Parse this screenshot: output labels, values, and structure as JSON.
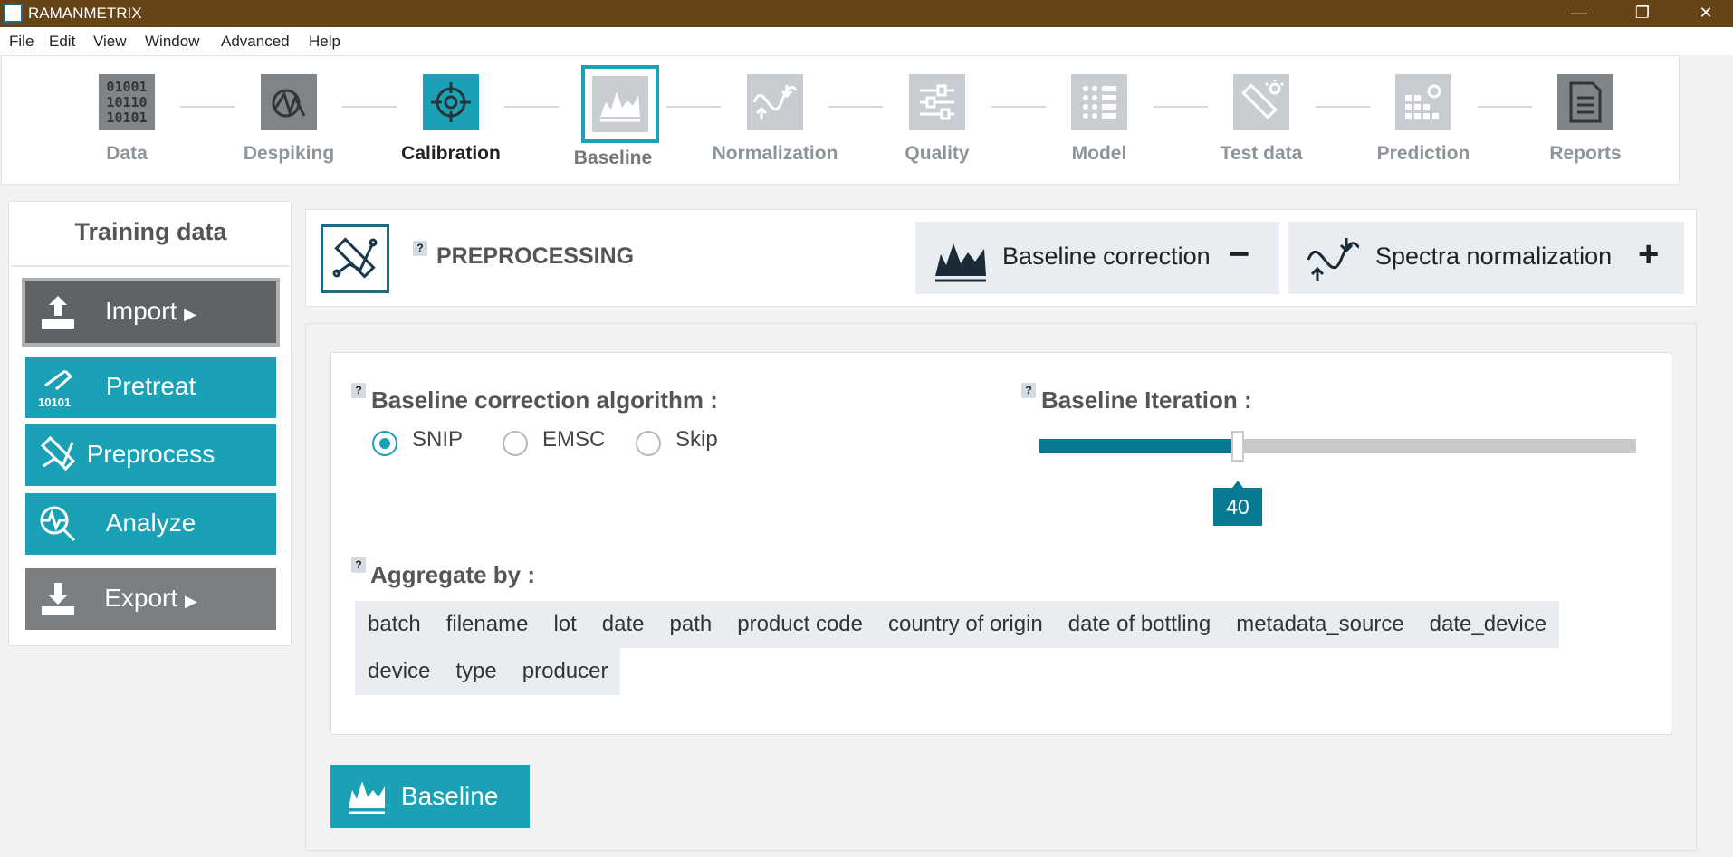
{
  "window": {
    "title": "RAMANMETRIX",
    "minimize": "—",
    "maximize": "❐",
    "close": "✕"
  },
  "menu": [
    "File",
    "Edit",
    "View",
    "Window",
    "Advanced",
    "Help"
  ],
  "workflow": {
    "steps": [
      {
        "label": "Data",
        "icon": "binary-data-icon"
      },
      {
        "label": "Despiking",
        "icon": "despiking-icon"
      },
      {
        "label": "Calibration",
        "icon": "crosshair-icon"
      },
      {
        "label": "Baseline",
        "icon": "baseline-spectrum-icon"
      },
      {
        "label": "Normalization",
        "icon": "normalization-icon"
      },
      {
        "label": "Quality",
        "icon": "sliders-icon"
      },
      {
        "label": "Model",
        "icon": "grid-model-icon"
      },
      {
        "label": "Test data",
        "icon": "test-data-icon"
      },
      {
        "label": "Prediction",
        "icon": "prediction-icon"
      },
      {
        "label": "Reports",
        "icon": "report-document-icon"
      }
    ],
    "active": "Baseline",
    "data_icon_text": [
      "01001",
      "10110",
      "10101"
    ]
  },
  "sidebar": {
    "title": "Training data",
    "buttons": {
      "import": "Import",
      "pretreat": "Pretreat",
      "pretreat_icon_text": "10101",
      "preprocess": "Preprocess",
      "analyze": "Analyze",
      "export": "Export"
    }
  },
  "header": {
    "help": "?",
    "title": "PREPROCESSING",
    "baseline_correction": "Baseline correction",
    "baseline_correction_toggle": "−",
    "spectra_normalization": "Spectra normalization",
    "spectra_normalization_toggle": "+"
  },
  "baseline_settings": {
    "algorithm_label": "Baseline correction algorithm :",
    "algorithm_options": [
      "SNIP",
      "EMSC",
      "Skip"
    ],
    "algorithm_selected": "SNIP",
    "iteration_label": "Baseline Iteration :",
    "iteration_value": "40",
    "iteration_fraction": 0.333,
    "aggregate_label": "Aggregate by :",
    "aggregate_row1": [
      "batch",
      "filename",
      "lot",
      "date",
      "path",
      "product code",
      "country of origin",
      "date of bottling",
      "metadata_source",
      "date_device"
    ],
    "aggregate_row2": [
      "device",
      "type",
      "producer"
    ]
  },
  "actions": {
    "baseline": "Baseline"
  },
  "colors": {
    "accent": "#1aa1b6",
    "dark_accent": "#067a91",
    "titlebar": "#664417"
  }
}
